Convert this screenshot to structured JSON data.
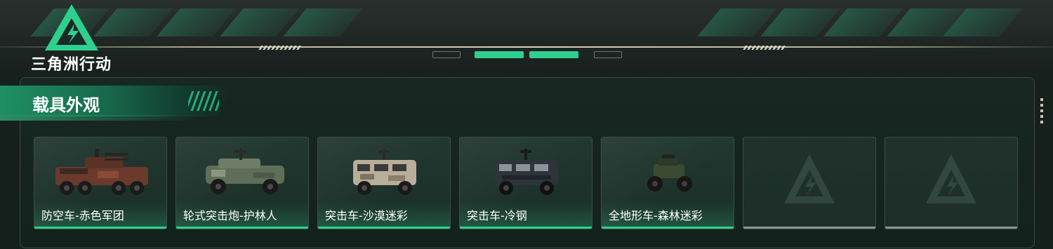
{
  "app": {
    "logo_text": "三角洲行动"
  },
  "panel": {
    "title": "载具外观"
  },
  "skins": [
    {
      "label": "防空车-赤色军团",
      "vehicle": "anti-air-vehicle",
      "selected": true
    },
    {
      "label": "轮式突击炮-护林人",
      "vehicle": "wheeled-assault-gun",
      "selected": true
    },
    {
      "label": "突击车-沙漠迷彩",
      "vehicle": "assault-vehicle-desert",
      "selected": true
    },
    {
      "label": "突击车-冷钢",
      "vehicle": "assault-vehicle-steel",
      "selected": true
    },
    {
      "label": "全地形车-森林迷彩",
      "vehicle": "atv-forest",
      "selected": true
    },
    {
      "label": "",
      "vehicle": "",
      "selected": false
    },
    {
      "label": "",
      "vehicle": "",
      "selected": false
    }
  ],
  "colors": {
    "accent": "#2fd08f",
    "empty_underline": "#8d938f"
  }
}
